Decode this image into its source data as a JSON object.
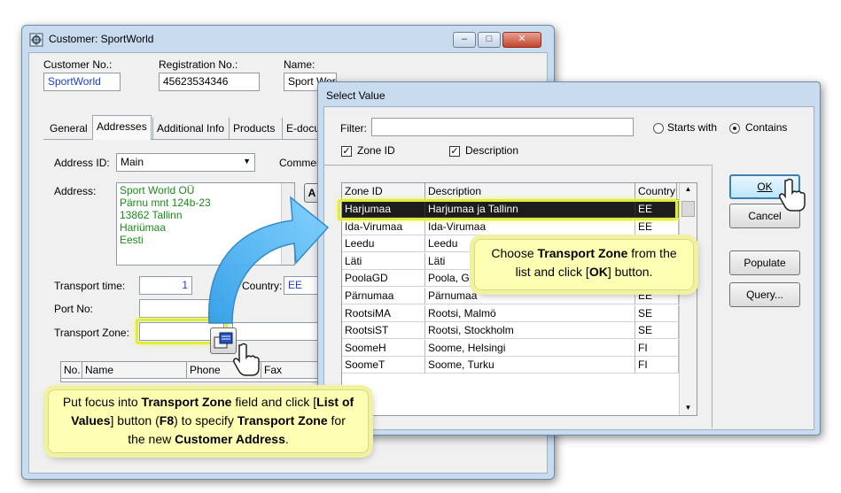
{
  "customer_window": {
    "title": "Customer: SportWorld",
    "controls": {
      "minimize": "–",
      "maximize": "□",
      "close": "✕"
    },
    "fields": {
      "customer_no_label": "Customer No.:",
      "customer_no_value": "SportWorld",
      "registration_no_label": "Registration No.:",
      "registration_no_value": "45623534346",
      "name_label": "Name:",
      "name_value": "Sport World OÜ"
    },
    "tabs": [
      "General",
      "Addresses",
      "Additional Info",
      "Products",
      "E-docu"
    ],
    "address_id_label": "Address ID:",
    "address_id_value": "Main",
    "comment_label": "Commen",
    "address_label": "Address:",
    "address_lines": [
      "Sport World OÜ",
      "Pärnu mnt 124b-23",
      "13862 Tallinn",
      "Hariümaa",
      "Eesti"
    ],
    "address_button_fragment": "A",
    "transport_time_label": "Transport time:",
    "transport_time_value": "1",
    "country_label": "Country:",
    "country_value": "EE",
    "port_no_label": "Port No:",
    "transport_zone_label": "Transport Zone:",
    "contacts_columns": [
      "No.",
      "Name",
      "Phone",
      "Fax"
    ]
  },
  "select_value_dialog": {
    "title": "Select Value",
    "filter_label": "Filter:",
    "filter_value": "",
    "starts_with_label": "Starts with",
    "contains_label": "Contains",
    "zone_id_check_label": "Zone ID",
    "description_check_label": "Description",
    "columns": [
      "Zone ID",
      "Description",
      "Country"
    ],
    "rows": [
      {
        "zone": "Harjumaa",
        "desc": "Harjumaa ja Tallinn",
        "country": "EE"
      },
      {
        "zone": "Ida-Virumaa",
        "desc": "Ida-Virumaa",
        "country": "EE"
      },
      {
        "zone": "Leedu",
        "desc": "Leedu",
        "country": ""
      },
      {
        "zone": "Läti",
        "desc": "Läti",
        "country": ""
      },
      {
        "zone": "PoolaGD",
        "desc": "Poola, Gd",
        "country": ""
      },
      {
        "zone": "Pärnumaa",
        "desc": "Pärnumaa",
        "country": "EE"
      },
      {
        "zone": "RootsiMA",
        "desc": "Rootsi, Malmö",
        "country": "SE"
      },
      {
        "zone": "RootsiST",
        "desc": "Rootsi, Stockholm",
        "country": "SE"
      },
      {
        "zone": "SoomeH",
        "desc": "Soome, Helsingi",
        "country": "FI"
      },
      {
        "zone": "SoomeT",
        "desc": "Soome, Turku",
        "country": "FI"
      }
    ],
    "buttons": {
      "ok": "OK",
      "cancel": "Cancel",
      "populate": "Populate",
      "query": "Query..."
    },
    "close": "✕"
  },
  "callouts": {
    "choose_zone": {
      "parts": [
        {
          "t": "Choose ",
          "b": false
        },
        {
          "t": "Transport Zone",
          "b": true
        },
        {
          "t": " from the list and click [",
          "b": false
        },
        {
          "t": "OK",
          "b": true
        },
        {
          "t": "] button.",
          "b": false
        }
      ]
    },
    "put_focus": {
      "parts": [
        {
          "t": "Put focus into ",
          "b": false
        },
        {
          "t": "Transport  Zone",
          "b": true
        },
        {
          "t": " field and click [",
          "b": false
        },
        {
          "t": "List of Values",
          "b": true
        },
        {
          "t": "] button (",
          "b": false
        },
        {
          "t": "F8",
          "b": true
        },
        {
          "t": ") to specify ",
          "b": false
        },
        {
          "t": "Transport Zone",
          "b": true
        },
        {
          "t": " for the new ",
          "b": false
        },
        {
          "t": "Customer Address",
          "b": true
        },
        {
          "t": ".",
          "b": false
        }
      ]
    }
  },
  "colors": {
    "accent_blue": "#1a3fd1",
    "address_green": "#1a8a1a",
    "callout_yellow": "#ffffb4",
    "highlight": "#e2ec37"
  },
  "icons": [
    "customer-window-icon",
    "list-of-values-icon",
    "hand-pointer-icon",
    "arrow-icon"
  ]
}
